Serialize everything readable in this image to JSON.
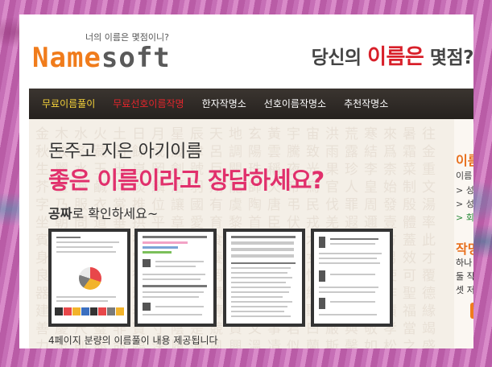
{
  "header": {
    "logo_tagline": "너의 이름은 몇점이니?",
    "logo_name": "Name",
    "logo_soft": "soft",
    "slogan_pre": "당신의 ",
    "slogan_accent": "이름은",
    "slogan_post": " 몇점?"
  },
  "nav": {
    "items": [
      {
        "label": "무료이름풀이"
      },
      {
        "label": "무료선호이름작명"
      },
      {
        "label": "한자작명소"
      },
      {
        "label": "선호이름작명소"
      },
      {
        "label": "추천작명소"
      }
    ]
  },
  "main": {
    "headline_1": "돈주고 지은 아기이름",
    "headline_2": "좋은 이름이라고 장담하세요?",
    "headline_3_bold": "공짜",
    "headline_3_rest": "로 확인하세요~",
    "caption": "4페이지 분량의 이름풀이 내용 제공됩니다"
  },
  "sidebar": {
    "title_1": "이름",
    "subtitle_1": "이름",
    "links": [
      "> 성명",
      "> 성명",
      "> 회원"
    ],
    "title_2": "작명",
    "lines": [
      "하나",
      "둘 작",
      "셋 저"
    ]
  },
  "colors": {
    "brand_orange": "#f07c1c",
    "accent_pink": "#e1306c",
    "nav_active": "#e6252c",
    "nav_bg": "#2d2824"
  }
}
